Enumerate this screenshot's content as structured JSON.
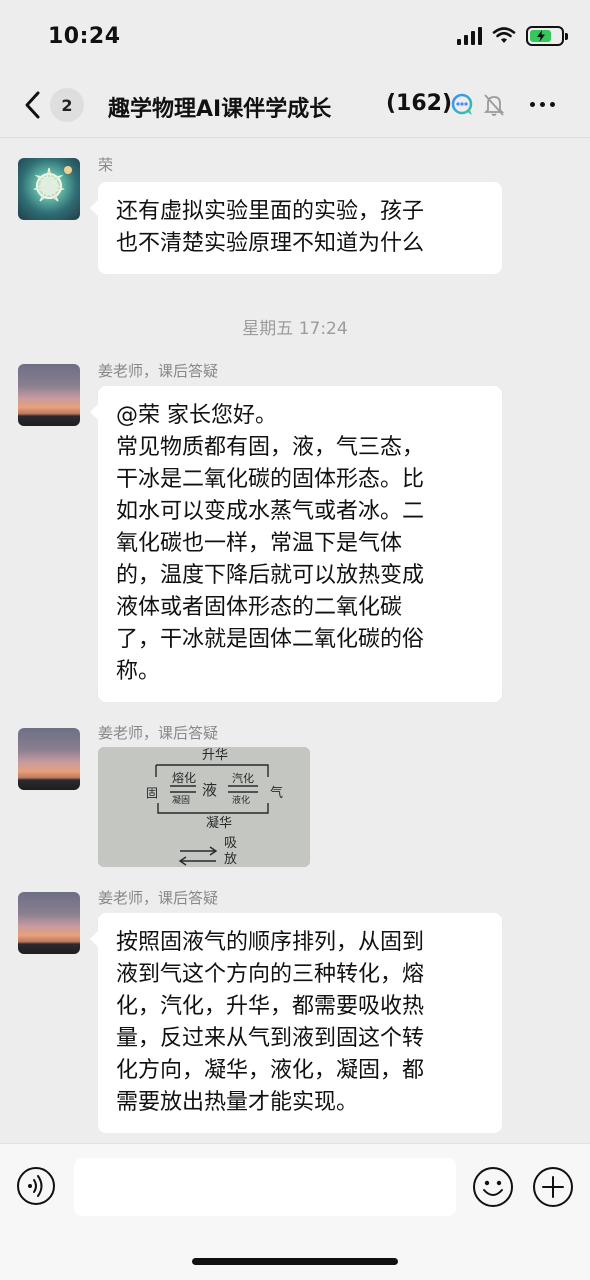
{
  "status_bar": {
    "time": "10:24"
  },
  "header": {
    "unread_count": "2",
    "title": "趣学物理AI课伴学成长",
    "member_count": "(162)"
  },
  "messages": [
    {
      "sender": "荣",
      "text": "还有虚拟实验里面的实验，孩子\n也不清楚实验原理不知道为什么"
    },
    {
      "sender": "姜老师，课后答疑",
      "text": "@荣 家长您好。\n常见物质都有固，液，气三态，\n干冰是二氧化碳的固体形态。比\n如水可以变成水蒸气或者冰。二\n氧化碳也一样，常温下是气体\n的，温度下降后就可以放热变成\n液体或者固体形态的二氧化碳\n了，干冰就是固体二氧化碳的俗\n称。"
    },
    {
      "sender": "姜老师，课后答疑"
    },
    {
      "sender": "姜老师，课后答疑",
      "text": "按照固液气的顺序排列，从固到\n液到气这个方向的三种转化，熔\n化，汽化，升华，都需要吸收热\n量，反过来从气到液到固这个转\n化方向，凝华，液化，凝固，都\n需要放出热量才能实现。"
    }
  ],
  "timestamp": "星期五 17:24",
  "photo": {
    "top_label": "升华",
    "left_label": "固",
    "middle_label": "液",
    "right_label": "气",
    "arrow1_upper": "熔化",
    "arrow1_lower": "凝固",
    "arrow2_upper": "汽化",
    "arrow2_lower": "液化",
    "bottom_label": "凝华",
    "legend_absorb": "吸",
    "legend_release": "放"
  },
  "icons": {
    "back": "chevron-left-icon",
    "ai": "ai-bubble-icon",
    "mute": "bell-slash-icon",
    "more": "ellipsis-icon",
    "voice": "voice-icon",
    "emoji": "emoji-icon",
    "plus": "plus-icon"
  },
  "colors": {
    "background": "#ededed",
    "bubble": "#ffffff",
    "battery": "#34c759"
  }
}
